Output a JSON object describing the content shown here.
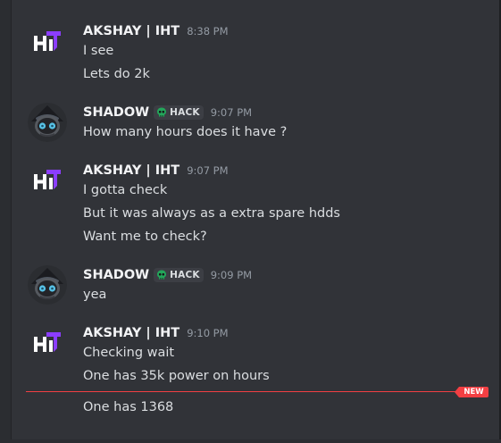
{
  "messages": [
    {
      "author": "AKSHAY | IHT",
      "time": "8:38 PM",
      "avatar": "iht-logo-icon",
      "lines": [
        "I see",
        "Lets do 2k"
      ]
    },
    {
      "author": "SHADOW",
      "tag": "HACK",
      "tag_icon": "skull-icon",
      "time": "9:07 PM",
      "avatar": "ninja-avatar",
      "lines": [
        "How many hours does it have ?"
      ]
    },
    {
      "author": "AKSHAY | IHT",
      "time": "9:07 PM",
      "avatar": "iht-logo-icon",
      "lines": [
        "I gotta check",
        "But it was always as a extra spare hdds",
        "Want me to check?"
      ]
    },
    {
      "author": "SHADOW",
      "tag": "HACK",
      "tag_icon": "skull-icon",
      "time": "9:09 PM",
      "avatar": "ninja-avatar",
      "lines": [
        "yea"
      ]
    },
    {
      "author": "AKSHAY | IHT",
      "time": "9:10 PM",
      "avatar": "iht-logo-icon",
      "lines": [
        "Checking wait",
        "One has 35k power on hours",
        "One has 1368"
      ]
    }
  ],
  "divider": {
    "label": "NEW"
  },
  "colors": {
    "background": "#313338",
    "username": "#f2f3f5",
    "text": "#dbdee1",
    "timestamp": "#949ba4",
    "new_divider": "#f23f43",
    "tag_icon": "#23a55a"
  }
}
